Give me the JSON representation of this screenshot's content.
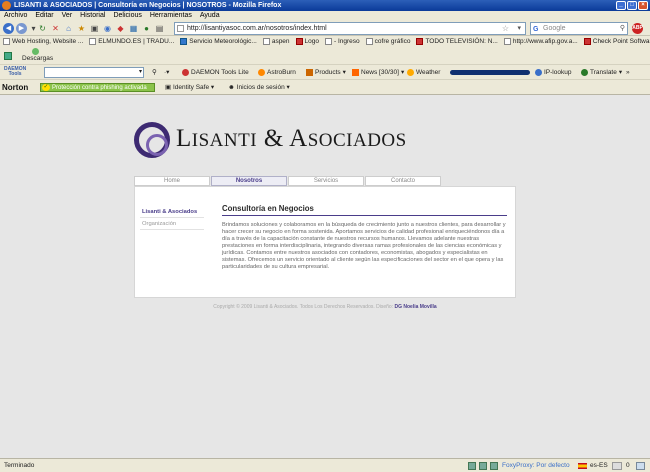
{
  "window": {
    "title": "LISANTI & ASOCIADOS | Consultoría en Negocios | NOSOTROS - Mozilla Firefox"
  },
  "menu": [
    "Archivo",
    "Editar",
    "Ver",
    "Historial",
    "Delicious",
    "Herramientas",
    "Ayuda"
  ],
  "nav": {
    "url": "http://lisantiyasoc.com.ar/nosotros/index.html",
    "search_placeholder": "Google"
  },
  "bookmarks": [
    "Web Hosting, Website ...",
    "ELMUNDO.ES | TRADU...",
    "Servicio Meteorológic...",
    "aspen",
    "Logo",
    "- Ingreso",
    "cofre gráfico",
    "TODO TELEVISIÓN: N...",
    "http://www.afip.gov.a...",
    "Check Point Software: ..."
  ],
  "downloads_label": "Descargas",
  "daemon_toolbar": {
    "logo": "DAEMON",
    "logo_sub": "Tools",
    "items": [
      "DAEMON Tools Lite",
      "AstroBurn",
      "Products",
      "News [30/30]",
      "Weather",
      "IP-lookup",
      "Translate"
    ]
  },
  "norton_toolbar": {
    "brand": "Norton",
    "phishing": "Protección contra phishing activada",
    "identity_safe": "Identity Safe",
    "sesion": "Inicios de sesión"
  },
  "site": {
    "brand_L": "L",
    "brand_isanti": "ISANTI",
    "brand_amp": " & ",
    "brand_A": "A",
    "brand_sociados": "SOCIADOS",
    "tabs": [
      "Home",
      "Nosotros",
      "Servicios",
      "Contacto"
    ],
    "active_tab": "Nosotros",
    "side_menu": [
      "Lisanti & Asociados",
      "Organización"
    ],
    "heading": "Consultoría en Negocios",
    "paragraph": "Brindamos soluciones y colaboramos en la búsqueda de crecimiento junto a nuestros clientes, para desarrollar y hacer crecer su negocio en forma sostenida. Aportamos servicios de calidad profesional enriqueciéndonos día a día a través de la capacitación constante de nuestros recursos humanos. Llevamos adelante nuestras prestaciones en forma interdisciplinaria, integrando diversas ramas profesionales de las ciencias económicas y jurídicas. Contamos entre nuestros asociados con contadores, economistas, abogados y especialistas en sistemas. Ofrecemos un servicio orientado al cliente según las especificaciones del sector en el que opera y las particularidades de su cultura empresarial.",
    "copyright": "Copyright © 2009 Lisanti & Asociados. Todos Los Derechos Reservados. Diseño: ",
    "designer": "DG Noelia Movilla"
  },
  "statusbar": {
    "text": "Terminado",
    "proxy": "FoxyProxy: Por defecto",
    "lang": "es-ES",
    "count": "0"
  },
  "colors": {
    "accent": "#4a3d8a",
    "titlebar": "#0a3a99"
  }
}
